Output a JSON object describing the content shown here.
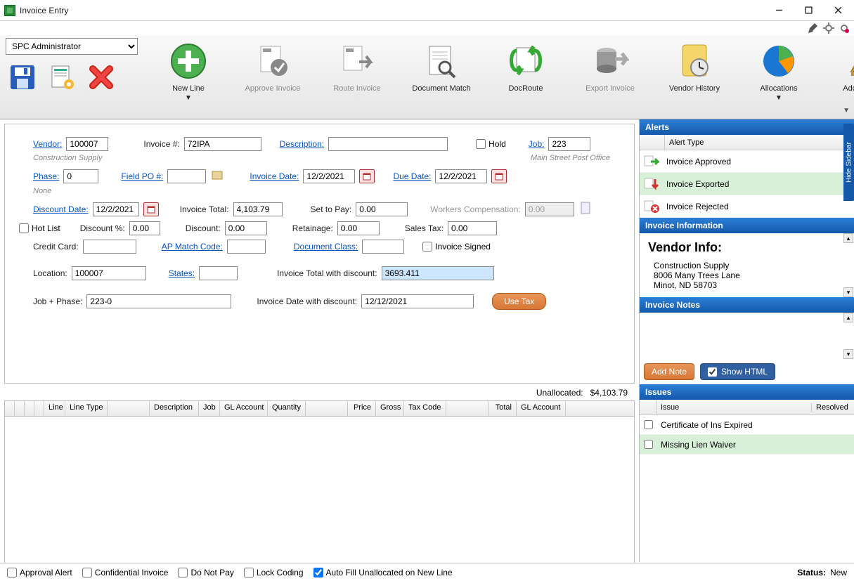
{
  "window": {
    "title": "Invoice Entry"
  },
  "user_select": "SPC Administrator",
  "toolbar": {
    "new_line": "New Line",
    "approve_invoice": "Approve Invoice",
    "route_invoice": "Route Invoice",
    "document_match": "Document Match",
    "docroute": "DocRoute",
    "export_invoice": "Export Invoice",
    "vendor_history": "Vendor History",
    "allocations": "Allocations",
    "add_vendor": "Add Vendor"
  },
  "form": {
    "vendor_label": "Vendor:",
    "vendor": "100007",
    "vendor_name": "Construction Supply",
    "invoice_num_label": "Invoice #:",
    "invoice_num": "72IPA",
    "description_label": "Description:",
    "description": "",
    "hold_label": "Hold",
    "job_label": "Job:",
    "job": "223",
    "job_name": "Main Street Post Office",
    "phase_label": "Phase:",
    "phase": "0",
    "phase_name": "None",
    "field_po_label": "Field PO #:",
    "field_po": "",
    "invoice_date_label": "Invoice Date:",
    "invoice_date": "12/2/2021",
    "due_date_label": "Due Date:",
    "due_date": "12/2/2021",
    "discount_date_label": "Discount Date:",
    "discount_date": "12/2/2021",
    "invoice_total_label": "Invoice Total:",
    "invoice_total": "4,103.79",
    "set_to_pay_label": "Set to Pay:",
    "set_to_pay": "0.00",
    "workers_comp_label": "Workers Compensation:",
    "workers_comp": "0.00",
    "hot_list_label": "Hot List",
    "discount_pct_label": "Discount %:",
    "discount_pct": "0.00",
    "discount_label": "Discount:",
    "discount": "0.00",
    "retainage_label": "Retainage:",
    "retainage": "0.00",
    "sales_tax_label": "Sales Tax:",
    "sales_tax": "0.00",
    "credit_card_label": "Credit Card:",
    "credit_card": "",
    "ap_match_label": "AP Match Code:",
    "ap_match": "",
    "doc_class_label": "Document Class:",
    "doc_class": "",
    "invoice_signed_label": "Invoice Signed",
    "location_label": "Location:",
    "location": "100007",
    "states_label": "States:",
    "states": "",
    "total_disc_label": "Invoice Total with discount:",
    "total_disc": "3693.411",
    "job_phase_label": "Job + Phase:",
    "job_phase": "223-0",
    "date_disc_label": "Invoice Date with discount:",
    "date_disc": "12/12/2021",
    "use_tax_btn": "Use Tax",
    "unallocated_label": "Unallocated:",
    "unallocated_value": "$4,103.79"
  },
  "grid": {
    "cols": [
      "",
      "",
      "",
      "",
      "Line",
      "Line Type",
      "",
      "Description",
      "Job",
      "GL Account",
      "Quantity",
      "",
      "Price",
      "Gross",
      "Tax Code",
      "",
      "Total",
      "GL Account"
    ]
  },
  "sidebar": {
    "alerts_title": "Alerts",
    "alert_type_hdr": "Alert Type",
    "alerts": [
      {
        "label": "Invoice Approved",
        "icon": "arrow-right",
        "selected": false
      },
      {
        "label": "Invoice Exported",
        "icon": "arrow-down",
        "selected": true
      },
      {
        "label": "Invoice Rejected",
        "icon": "x-red",
        "selected": false
      }
    ],
    "info_title": "Invoice Information",
    "vendor_info_heading": "Vendor Info:",
    "vendor_lines": [
      "Construction Supply",
      "8006 Many Trees Lane",
      "Minot, ND 58703"
    ],
    "notes_title": "Invoice Notes",
    "add_note": "Add Note",
    "show_html": "Show HTML",
    "issues_title": "Issues",
    "issues_hdr_issue": "Issue",
    "issues_hdr_resolved": "Resolved",
    "issues": [
      {
        "label": "Certificate of Ins Expired",
        "selected": false
      },
      {
        "label": "Missing Lien Waiver",
        "selected": true
      }
    ],
    "hide_sidebar": "Hide Sidebar"
  },
  "bottom": {
    "approval_alert": "Approval Alert",
    "confidential": "Confidential Invoice",
    "do_not_pay": "Do Not Pay",
    "lock_coding": "Lock Coding",
    "auto_fill": "Auto Fill Unallocated on New Line",
    "status_label": "Status:",
    "status_value": "New"
  }
}
